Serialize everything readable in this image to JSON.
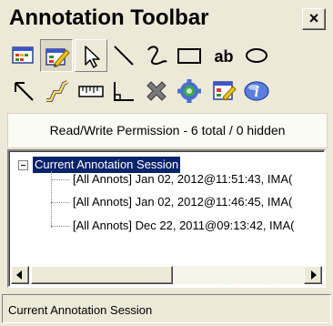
{
  "window": {
    "title": "Annotation Toolbar",
    "close_label": "×"
  },
  "toolbar": {
    "row1": [
      {
        "icon": "annotation-list-icon"
      },
      {
        "icon": "edit-annotation-icon"
      },
      {
        "icon": "select-arrow-icon"
      },
      {
        "icon": "line-icon"
      },
      {
        "icon": "freehand-icon"
      },
      {
        "icon": "rectangle-icon"
      },
      {
        "icon": "text-icon",
        "label": "ab"
      },
      {
        "icon": "ellipse-icon"
      }
    ],
    "row2": [
      {
        "icon": "arrow-icon"
      },
      {
        "icon": "polyline-icon"
      },
      {
        "icon": "ruler-icon"
      },
      {
        "icon": "angle-icon"
      },
      {
        "icon": "delete-icon"
      },
      {
        "icon": "settings-icon"
      },
      {
        "icon": "properties-icon"
      },
      {
        "icon": "help-icon"
      }
    ]
  },
  "permission": {
    "text": "Read/Write Permission - 6 total / 0 hidden"
  },
  "tree": {
    "root": {
      "label": "Current Annotation Session",
      "expanded": true,
      "children": [
        {
          "label": "[All Annots] Jan 02, 2012@11:51:43, IMA("
        },
        {
          "label": "[All Annots] Jan 02, 2012@11:46:45, IMA("
        },
        {
          "label": "[All Annots] Dec 22, 2011@09:13:42, IMA("
        }
      ]
    }
  },
  "status": {
    "text": "Current Annotation Session"
  },
  "colors": {
    "selection": "#0a246a",
    "chrome": "#ece9d8"
  }
}
